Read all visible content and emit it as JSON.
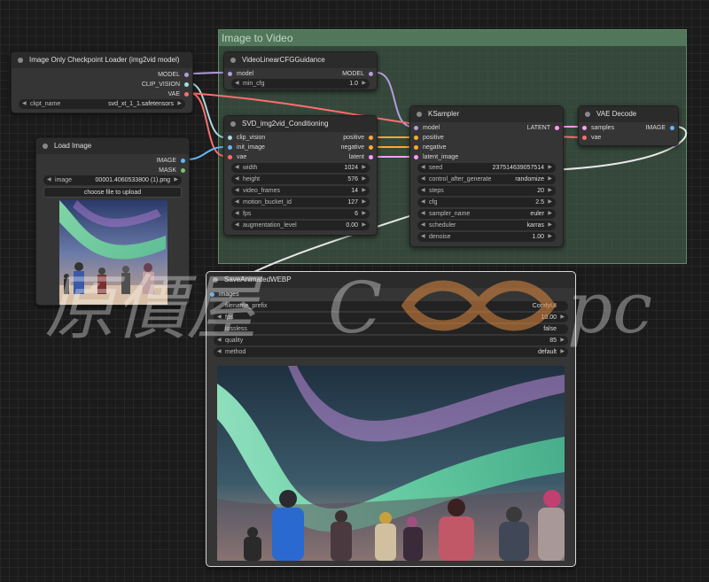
{
  "group": {
    "title": "Image to Video"
  },
  "checkpoint_loader": {
    "title": "Image Only Checkpoint Loader (img2vid model)",
    "outputs": [
      "MODEL",
      "CLIP_VISION",
      "VAE"
    ],
    "ckpt_label": "ckpt_name",
    "ckpt_value": "svd_xt_1_1.safetensors"
  },
  "load_image": {
    "title": "Load Image",
    "outputs": [
      "IMAGE",
      "MASK"
    ],
    "image_label": "image",
    "image_value": "00001.4060533800 (1).png",
    "upload_label": "choose file to upload"
  },
  "cfg_guidance": {
    "title": "VideoLinearCFGGuidance",
    "input": "model",
    "output": "MODEL",
    "widget_label": "min_cfg",
    "widget_value": "1.0"
  },
  "conditioning": {
    "title": "SVD_img2vid_Conditioning",
    "inputs": [
      "clip_vision",
      "init_image",
      "vae"
    ],
    "outputs": [
      "positive",
      "negative",
      "latent"
    ],
    "widgets": [
      {
        "label": "width",
        "value": "1024"
      },
      {
        "label": "height",
        "value": "576"
      },
      {
        "label": "video_frames",
        "value": "14"
      },
      {
        "label": "motion_bucket_id",
        "value": "127"
      },
      {
        "label": "fps",
        "value": "6"
      },
      {
        "label": "augmentation_level",
        "value": "0.00"
      }
    ]
  },
  "ksampler": {
    "title": "KSampler",
    "inputs": [
      "model",
      "positive",
      "negative",
      "latent_image"
    ],
    "output": "LATENT",
    "widgets": [
      {
        "label": "seed",
        "value": "237514639057514"
      },
      {
        "label": "control_after_generate",
        "value": "randomize"
      },
      {
        "label": "steps",
        "value": "20"
      },
      {
        "label": "cfg",
        "value": "2.5"
      },
      {
        "label": "sampler_name",
        "value": "euler"
      },
      {
        "label": "scheduler",
        "value": "karras"
      },
      {
        "label": "denoise",
        "value": "1.00"
      }
    ]
  },
  "vae_decode": {
    "title": "VAE Decode",
    "inputs": [
      "samples",
      "vae"
    ],
    "output": "IMAGE"
  },
  "save_webp": {
    "title": "SaveAnimatedWEBP",
    "input": "images",
    "widgets": [
      {
        "label": "filename_prefix",
        "value": "ComfyUI"
      },
      {
        "label": "fps",
        "value": "10.00"
      },
      {
        "label": "lossless",
        "value": "false"
      },
      {
        "label": "quality",
        "value": "85"
      },
      {
        "label": "method",
        "value": "default"
      }
    ]
  },
  "colors": {
    "model": "#b39ddb",
    "clip_vision": "#a8dadc",
    "vae": "#ff6e6e",
    "image": "#64b5f6",
    "conditioning": "#ffa931",
    "latent": "#ff9cf9",
    "white_wire": "#e8e8e8"
  },
  "icons": {
    "node_dot": "circle-dot-icon",
    "arrow_left": "arrow-left-icon",
    "arrow_right": "arrow-right-icon"
  }
}
